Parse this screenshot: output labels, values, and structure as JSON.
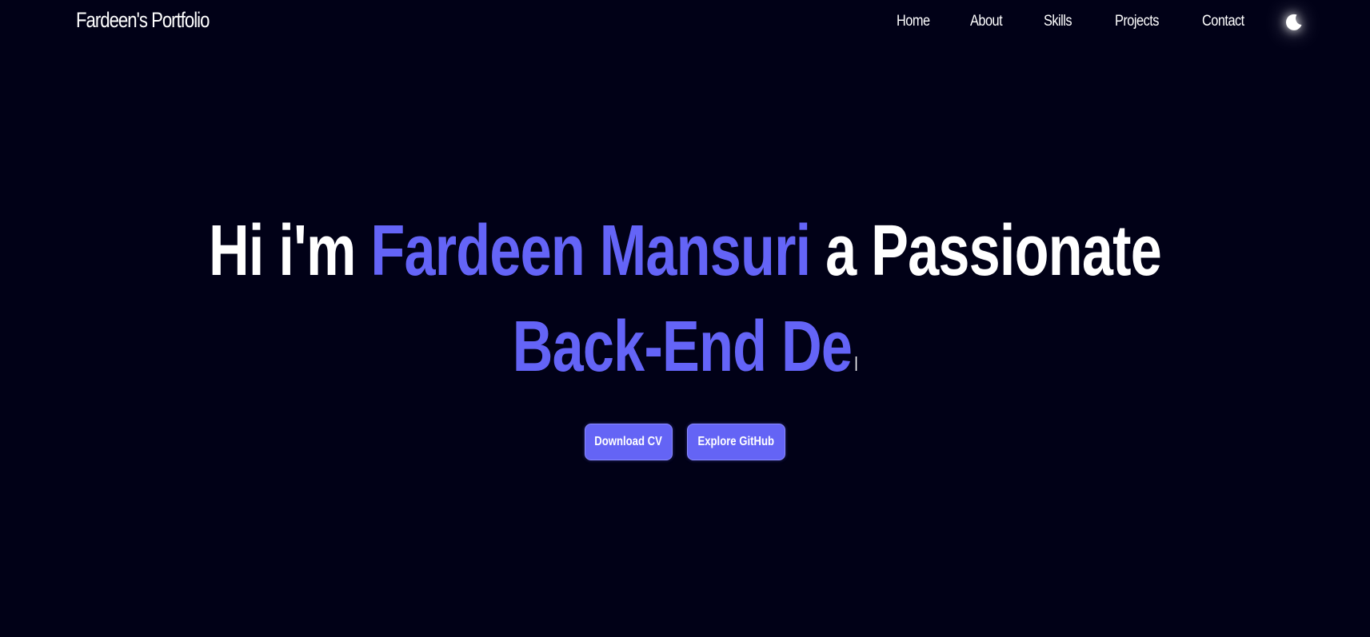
{
  "header": {
    "brand": "Fardeen's Portfolio",
    "nav": [
      {
        "label": "Home"
      },
      {
        "label": "About"
      },
      {
        "label": "Skills"
      },
      {
        "label": "Projects"
      },
      {
        "label": "Contact"
      }
    ],
    "theme_toggle_icon": "moon-icon"
  },
  "hero": {
    "greeting": "Hi i'm",
    "name": "Fardeen Mansuri",
    "tagline": "a Passionate",
    "typed_role": "Back-End De"
  },
  "actions": {
    "download_cv": "Download CV",
    "explore_github": "Explore GitHub"
  },
  "colors": {
    "background": "#010117",
    "accent": "#6464f7",
    "text": "#ffffff"
  }
}
